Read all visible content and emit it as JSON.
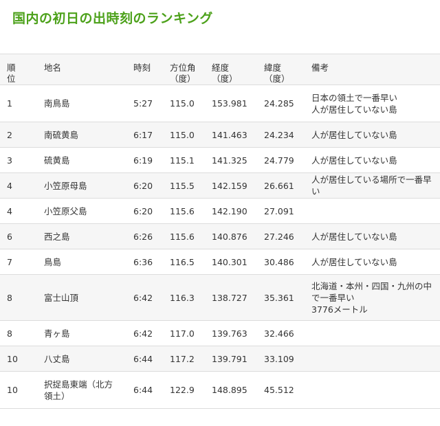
{
  "title": "国内の初日の出時刻のランキング",
  "headers": {
    "rank": "順\n位",
    "place": "地名",
    "time": "時刻",
    "azimuth": "方位角\n（度）",
    "longitude": "経度\n（度）",
    "latitude": "緯度\n（度）",
    "note": "備考"
  },
  "rows": [
    {
      "rank": "1",
      "place": "南鳥島",
      "time": "5:27",
      "azimuth": "115.0",
      "longitude": "153.981",
      "latitude": "24.285",
      "note": "日本の領土で一番早い\n人が居住していない島"
    },
    {
      "rank": "2",
      "place": "南硫黄島",
      "time": "6:17",
      "azimuth": "115.0",
      "longitude": "141.463",
      "latitude": "24.234",
      "note": "人が居住していない島"
    },
    {
      "rank": "3",
      "place": "硫黄島",
      "time": "6:19",
      "azimuth": "115.1",
      "longitude": "141.325",
      "latitude": "24.779",
      "note": "人が居住していない島"
    },
    {
      "rank": "4",
      "place": "小笠原母島",
      "time": "6:20",
      "azimuth": "115.5",
      "longitude": "142.159",
      "latitude": "26.661",
      "note": "人が居住している場所で一番早い"
    },
    {
      "rank": "4",
      "place": "小笠原父島",
      "time": "6:20",
      "azimuth": "115.6",
      "longitude": "142.190",
      "latitude": "27.091",
      "note": ""
    },
    {
      "rank": "6",
      "place": "西之島",
      "time": "6:26",
      "azimuth": "115.6",
      "longitude": "140.876",
      "latitude": "27.246",
      "note": "人が居住していない島"
    },
    {
      "rank": "7",
      "place": "鳥島",
      "time": "6:36",
      "azimuth": "116.5",
      "longitude": "140.301",
      "latitude": "30.486",
      "note": "人が居住していない島"
    },
    {
      "rank": "8",
      "place": "富士山頂",
      "time": "6:42",
      "azimuth": "116.3",
      "longitude": "138.727",
      "latitude": "35.361",
      "note": "北海道・本州・四国・九州の中\nで一番早い\n3776メートル"
    },
    {
      "rank": "8",
      "place": "青ヶ島",
      "time": "6:42",
      "azimuth": "117.0",
      "longitude": "139.763",
      "latitude": "32.466",
      "note": ""
    },
    {
      "rank": "10",
      "place": "八丈島",
      "time": "6:44",
      "azimuth": "117.2",
      "longitude": "139.791",
      "latitude": "33.109",
      "note": ""
    },
    {
      "rank": "10",
      "place": "択捉島東端（北方\n領土）",
      "time": "6:44",
      "azimuth": "122.9",
      "longitude": "148.895",
      "latitude": "45.512",
      "note": ""
    }
  ]
}
